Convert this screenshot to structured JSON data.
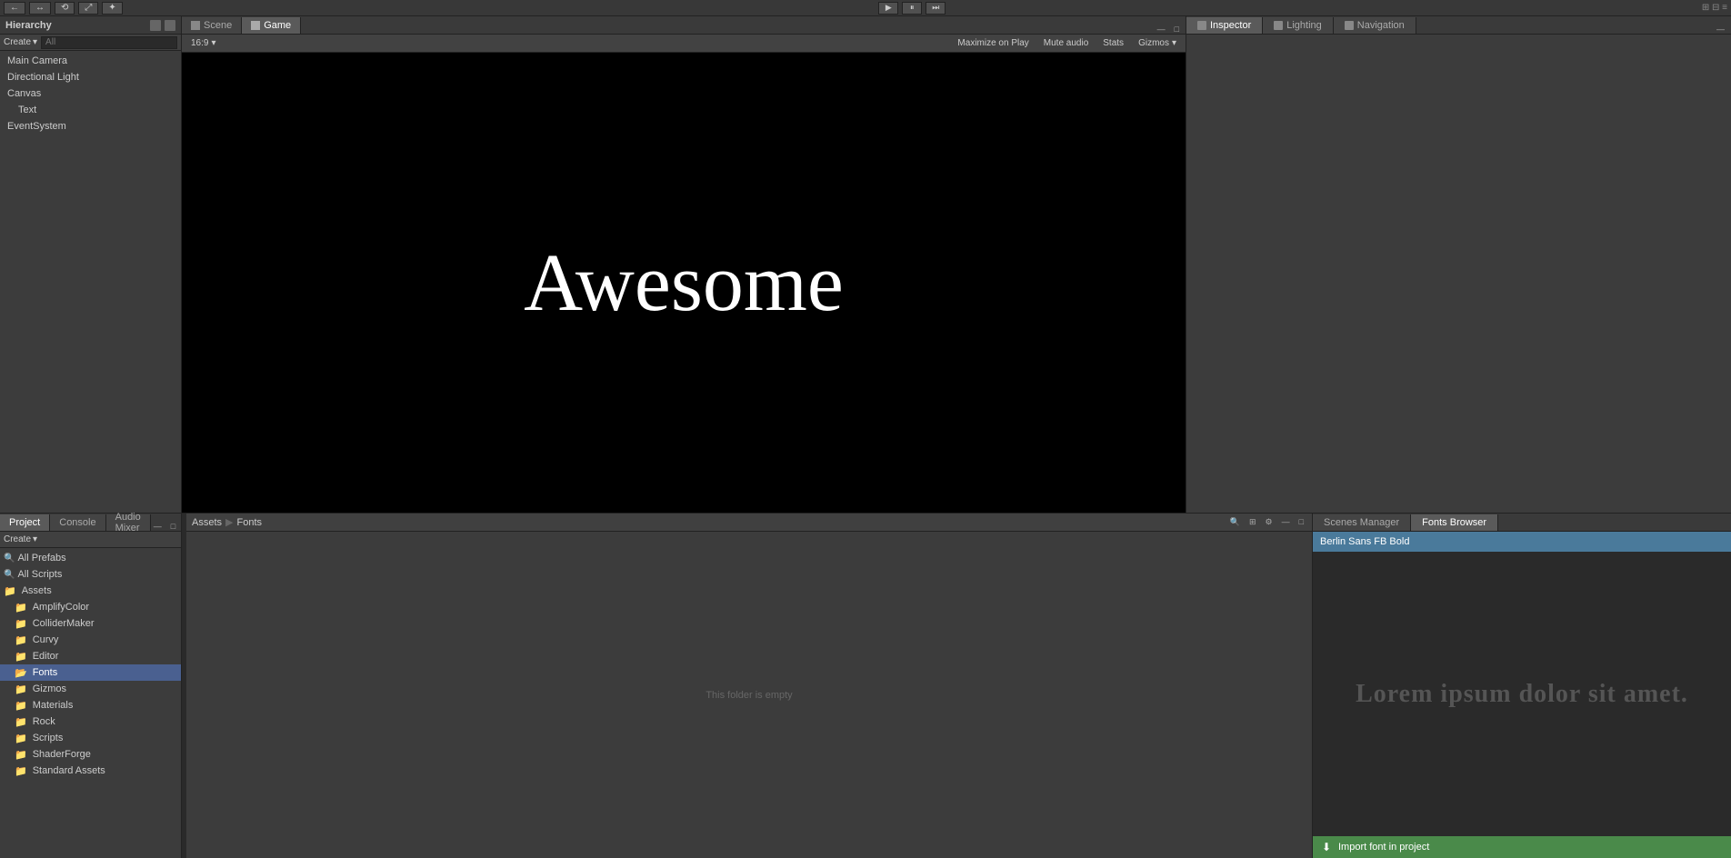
{
  "toolbar": {
    "create_label": "Create",
    "play_icon": "▶",
    "pause_icon": "⏸",
    "step_icon": "⏭"
  },
  "tabs": {
    "scene_label": "Scene",
    "game_label": "Game"
  },
  "game_toolbar": {
    "aspect_label": "16:9",
    "maximize_label": "Maximize on Play",
    "mute_label": "Mute audio",
    "stats_label": "Stats",
    "gizmos_label": "Gizmos"
  },
  "hierarchy": {
    "title": "Hierarchy",
    "create_label": "Create",
    "all_label": "All",
    "items": [
      {
        "label": "Main Camera",
        "level": 0
      },
      {
        "label": "Directional Light",
        "level": 0
      },
      {
        "label": "Canvas",
        "level": 0
      },
      {
        "label": "Text",
        "level": 1
      },
      {
        "label": "EventSystem",
        "level": 0
      }
    ]
  },
  "inspector": {
    "title": "Inspector",
    "tabs": [
      {
        "label": "Inspector",
        "active": true
      },
      {
        "label": "Lighting"
      },
      {
        "label": "Navigation"
      }
    ]
  },
  "viewport": {
    "awesome_text": "Awesome"
  },
  "project": {
    "title": "Project",
    "tabs": [
      {
        "label": "Project",
        "active": true
      },
      {
        "label": "Console"
      },
      {
        "label": "Audio Mixer"
      }
    ],
    "create_label": "Create",
    "search_placeholder": "",
    "tree": {
      "all_prefabs": "All Prefabs",
      "all_scripts": "All Scripts",
      "assets_label": "Assets",
      "items": [
        {
          "label": "AmplifyColor",
          "indent": 1
        },
        {
          "label": "ColliderMaker",
          "indent": 1
        },
        {
          "label": "Curvy",
          "indent": 1
        },
        {
          "label": "Editor",
          "indent": 1
        },
        {
          "label": "Fonts",
          "indent": 1,
          "active": true
        },
        {
          "label": "Gizmos",
          "indent": 1
        },
        {
          "label": "Materials",
          "indent": 1
        },
        {
          "label": "Rock",
          "indent": 1
        },
        {
          "label": "Scripts",
          "indent": 1
        },
        {
          "label": "ShaderForge",
          "indent": 1
        },
        {
          "label": "Standard Assets",
          "indent": 1
        }
      ]
    }
  },
  "file_browser": {
    "breadcrumb": [
      "Assets",
      "Fonts"
    ],
    "breadcrumb_sep": "▶",
    "empty_message": "This folder is empty"
  },
  "fonts_browser": {
    "tabs": [
      {
        "label": "Scenes Manager"
      },
      {
        "label": "Fonts Browser",
        "active": true
      }
    ],
    "selected_font": "Berlin Sans FB Bold",
    "preview_text": "Lorem ipsum dolor sit amet.",
    "import_label": "Import font in project"
  }
}
